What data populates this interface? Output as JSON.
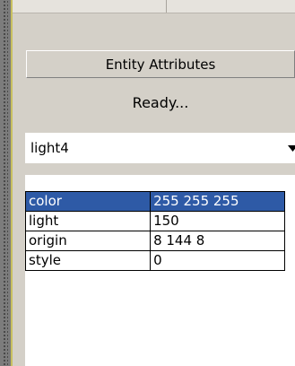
{
  "section": {
    "title": "Entity Attributes"
  },
  "status": {
    "text": "Ready..."
  },
  "entity_select": {
    "selected": "light4",
    "arrow_icon": "dropdown-arrow-icon"
  },
  "attributes": {
    "rows": [
      {
        "key": "color",
        "value": "255 255 255",
        "selected": true
      },
      {
        "key": "light",
        "value": "150",
        "selected": false
      },
      {
        "key": "origin",
        "value": "8 144 8",
        "selected": false
      },
      {
        "key": "style",
        "value": "0",
        "selected": false
      }
    ]
  },
  "colors": {
    "selection": "#2e5aa6",
    "panel": "#d4d0c8"
  }
}
